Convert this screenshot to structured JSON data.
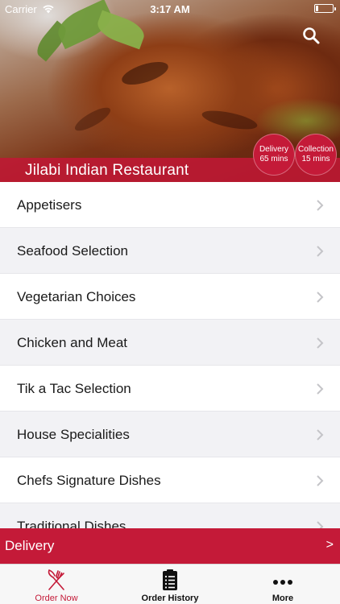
{
  "status_bar": {
    "carrier": "Carrier",
    "time": "3:17 AM",
    "battery_level": 0.15,
    "icons": [
      "wifi-icon",
      "battery-icon"
    ]
  },
  "header": {
    "restaurant_name": "Jilabi Indian Restaurant",
    "search_icon": "search-icon",
    "delivery_badge": {
      "label": "Delivery",
      "value": "65 mins"
    },
    "collection_badge": {
      "label": "Collection",
      "value": "15 mins"
    }
  },
  "menu": {
    "categories": [
      {
        "label": "Appetisers"
      },
      {
        "label": "Seafood Selection"
      },
      {
        "label": "Vegetarian Choices"
      },
      {
        "label": "Chicken and Meat"
      },
      {
        "label": "Tik a Tac Selection"
      },
      {
        "label": "House Specialities"
      },
      {
        "label": "Chefs Signature Dishes"
      },
      {
        "label": "Traditional Dishes"
      }
    ]
  },
  "delivery_bar": {
    "label": "Delivery",
    "arrow": ">"
  },
  "tab_bar": {
    "tabs": [
      {
        "label": "Order Now",
        "icon": "fork-knife-icon",
        "active": true
      },
      {
        "label": "Order History",
        "icon": "clipboard-list-icon",
        "active": false
      },
      {
        "label": "More",
        "icon": "more-dots-icon",
        "active": false
      }
    ]
  },
  "colors": {
    "accent": "#c41a38",
    "row_alt": "#f2f2f5",
    "tab_bar_bg": "#f7f7f7"
  }
}
